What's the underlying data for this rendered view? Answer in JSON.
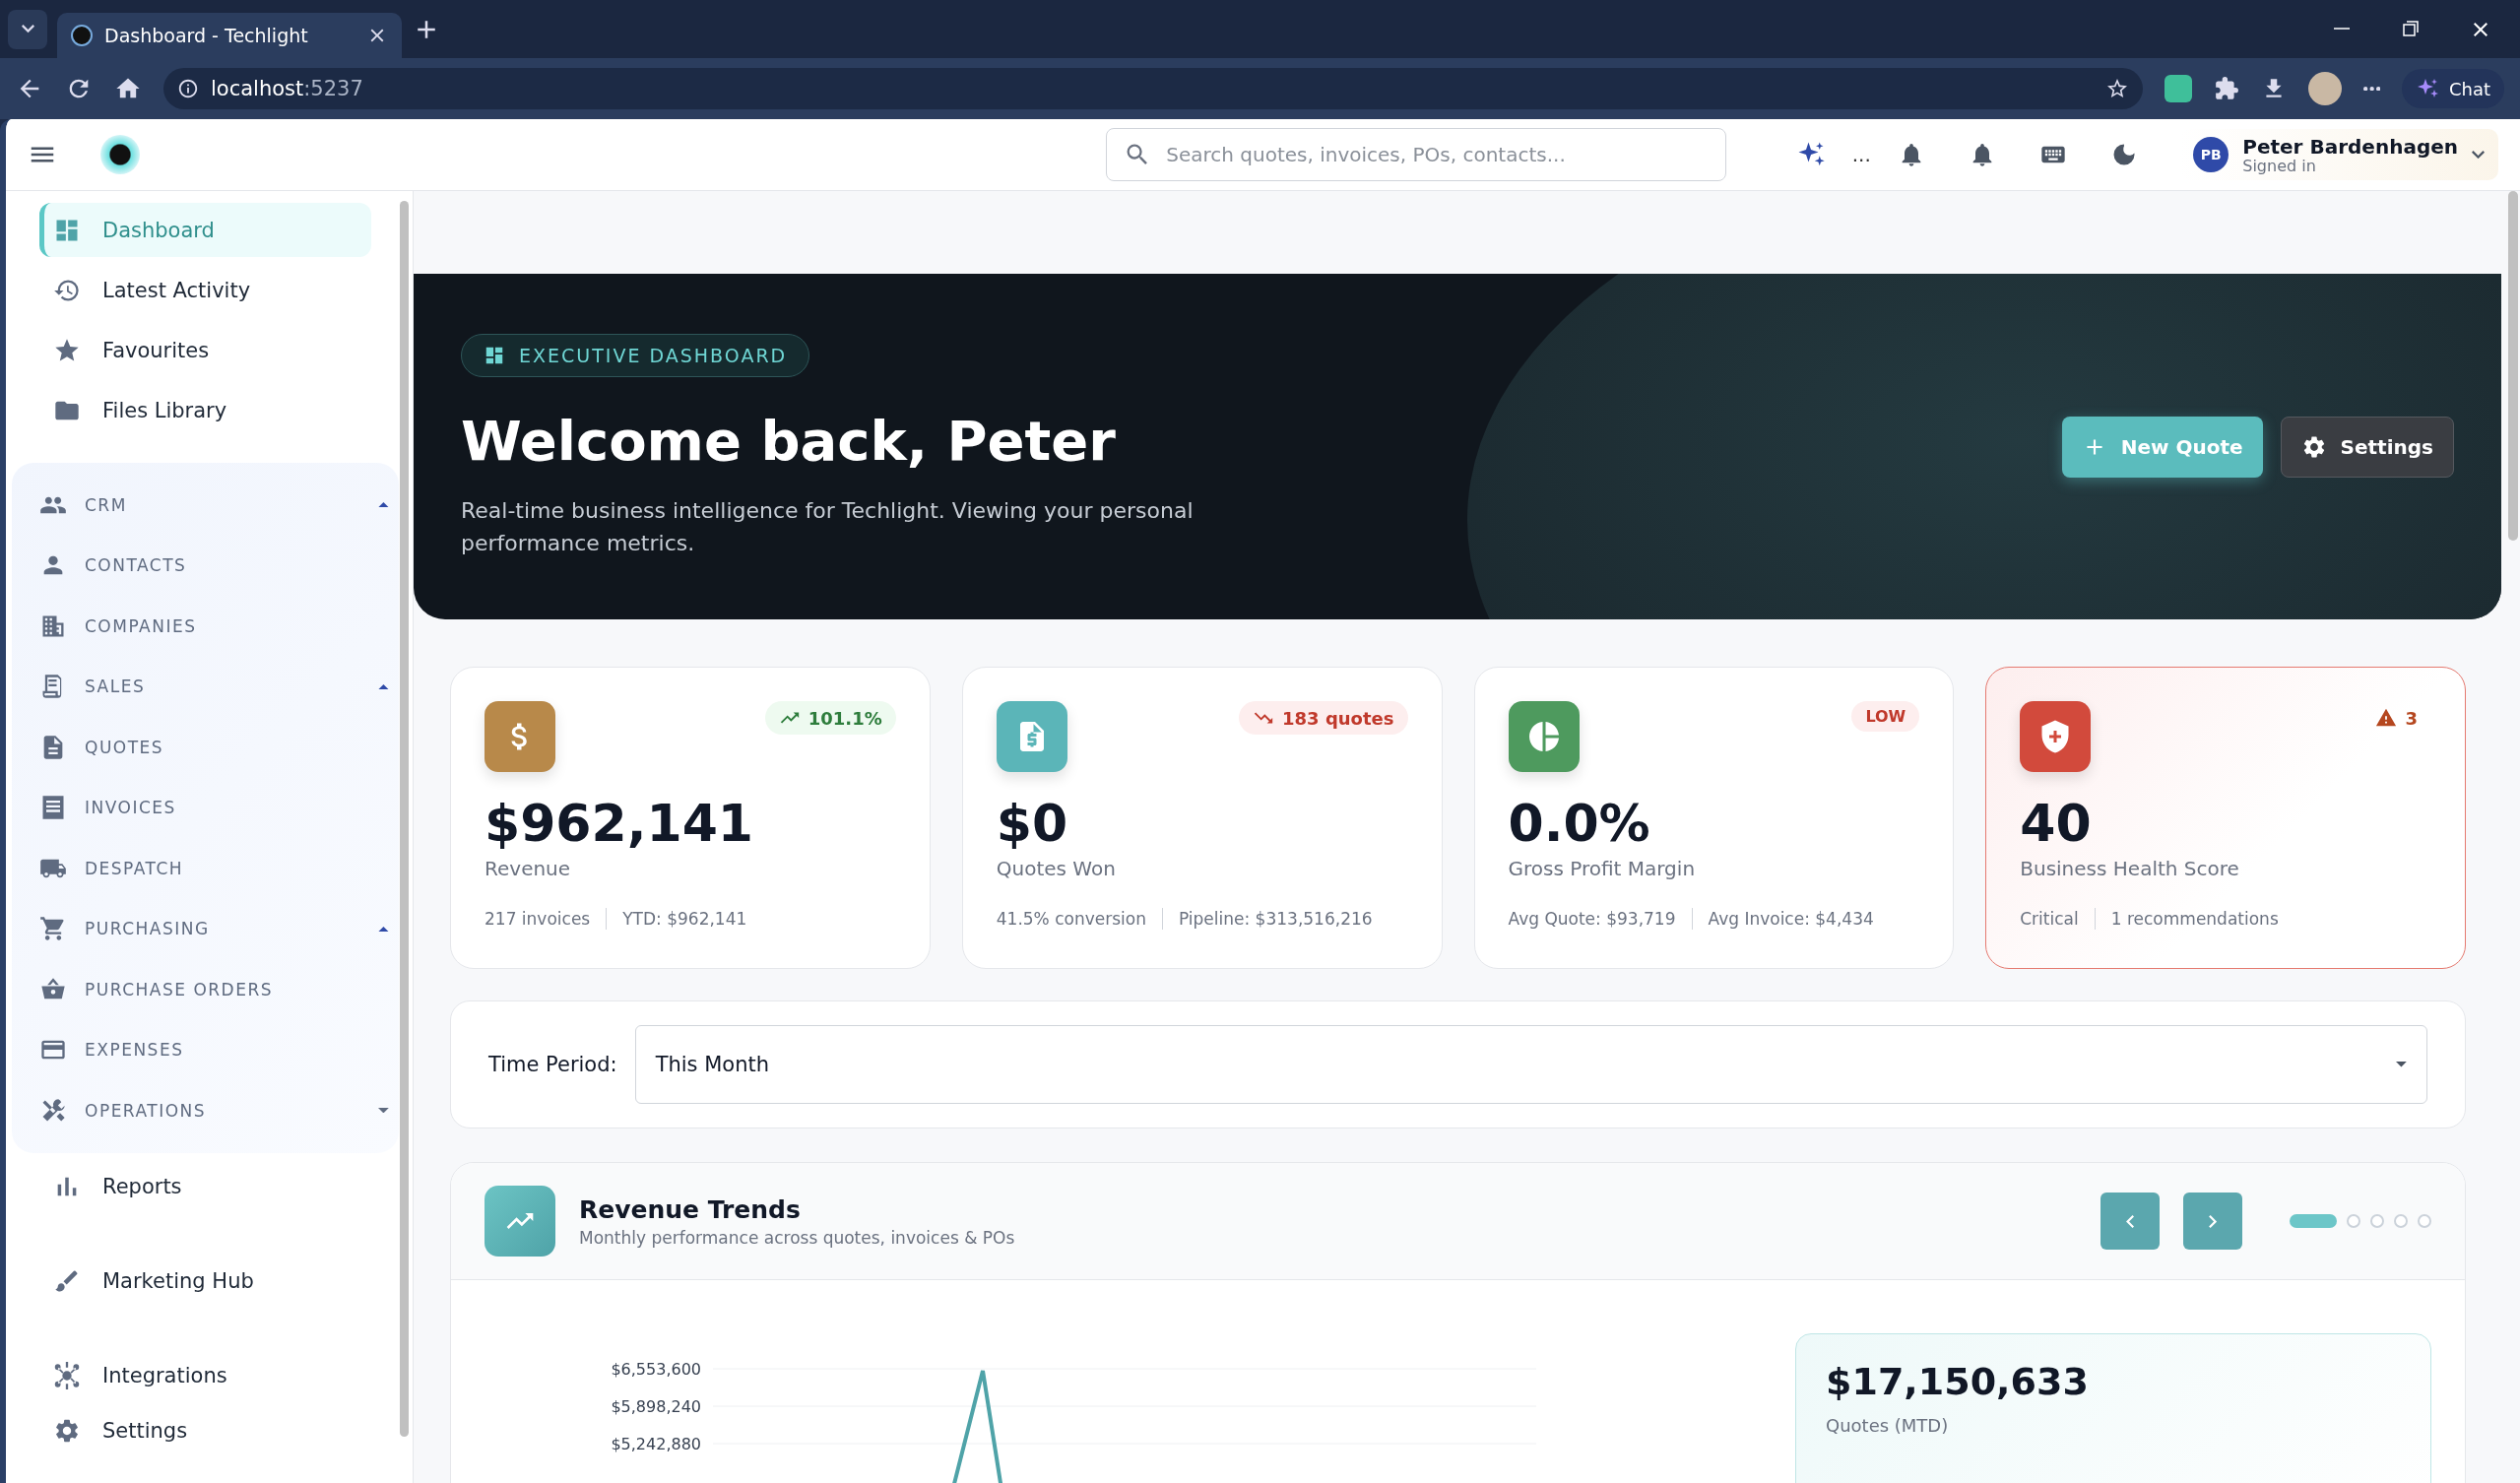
{
  "browser": {
    "tab_title": "Dashboard - Techlight",
    "url_host": "localhost",
    "url_port": ":5237",
    "chat_label": "Chat"
  },
  "header": {
    "search_placeholder": "Search quotes, invoices, POs, contacts...",
    "more_label": "...",
    "user": {
      "initials": "PB",
      "name": "Peter Bardenhagen",
      "status": "Signed in"
    }
  },
  "sidebar": {
    "top_items": [
      {
        "label": "Dashboard",
        "selected": true
      },
      {
        "label": "Latest Activity",
        "selected": false
      },
      {
        "label": "Favourites",
        "selected": false
      },
      {
        "label": "Files Library",
        "selected": false
      }
    ],
    "group_items": [
      {
        "label": "CRM",
        "kind": "section",
        "expanded": true
      },
      {
        "label": "CONTACTS",
        "kind": "link"
      },
      {
        "label": "COMPANIES",
        "kind": "link"
      },
      {
        "label": "SALES",
        "kind": "section",
        "expanded": true
      },
      {
        "label": "QUOTES",
        "kind": "link"
      },
      {
        "label": "INVOICES",
        "kind": "link"
      },
      {
        "label": "DESPATCH",
        "kind": "link"
      },
      {
        "label": "PURCHASING",
        "kind": "section",
        "expanded": true
      },
      {
        "label": "PURCHASE ORDERS",
        "kind": "link"
      },
      {
        "label": "EXPENSES",
        "kind": "link"
      },
      {
        "label": "OPERATIONS",
        "kind": "section",
        "expanded": false
      }
    ],
    "bottom_items": [
      {
        "label": "Reports",
        "selected": false
      },
      {
        "label": "Marketing Hub",
        "selected": false
      },
      {
        "label": "Integrations",
        "selected": false
      },
      {
        "label": "Settings",
        "selected": false
      }
    ]
  },
  "hero": {
    "badge": "EXECUTIVE DASHBOARD",
    "title": "Welcome back, Peter",
    "subtitle": "Real-time business intelligence for Techlight. Viewing your personal performance metrics.",
    "buttons": [
      {
        "label": "New Quote",
        "kind": "primary"
      },
      {
        "label": "Settings",
        "kind": "secondary"
      }
    ]
  },
  "kpis": [
    {
      "value": "$962,141",
      "label": "Revenue",
      "color": "#b8894a",
      "alert": false,
      "badge": {
        "text": "101.1%",
        "kind": "up"
      },
      "details": [
        "217 invoices",
        "YTD: $962,141"
      ]
    },
    {
      "value": "$0",
      "label": "Quotes Won",
      "color": "#5bb5b8",
      "alert": false,
      "badge": {
        "text": "183 quotes",
        "kind": "down"
      },
      "details": [
        "41.5% conversion",
        "Pipeline: $313,516,216"
      ]
    },
    {
      "value": "0.0%",
      "label": "Gross Profit Margin",
      "color": "#4e9a5e",
      "alert": false,
      "badge": {
        "text": "LOW",
        "kind": "low"
      },
      "details": [
        "Avg Quote: $93,719",
        "Avg Invoice: $4,434"
      ]
    },
    {
      "value": "40",
      "label": "Business Health Score",
      "color": "#d24a3c",
      "alert": true,
      "badge": {
        "text": "3",
        "kind": "warning"
      },
      "details": [
        "Critical",
        "1 recommendations"
      ]
    }
  ],
  "time_period": {
    "label": "Time Period:",
    "value": "This Month"
  },
  "revenue_trends": {
    "title": "Revenue Trends",
    "subtitle": "Monthly performance across quotes, invoices & POs",
    "pages": [
      {
        "selected": true
      },
      {
        "selected": false
      },
      {
        "selected": false
      },
      {
        "selected": false
      },
      {
        "selected": false
      }
    ],
    "y_tick_labels": [
      "$6,553,600",
      "$5,898,240",
      "$5,242,880"
    ],
    "summary": {
      "value": "$17,150,633",
      "label": "Quotes (MTD)"
    }
  }
}
